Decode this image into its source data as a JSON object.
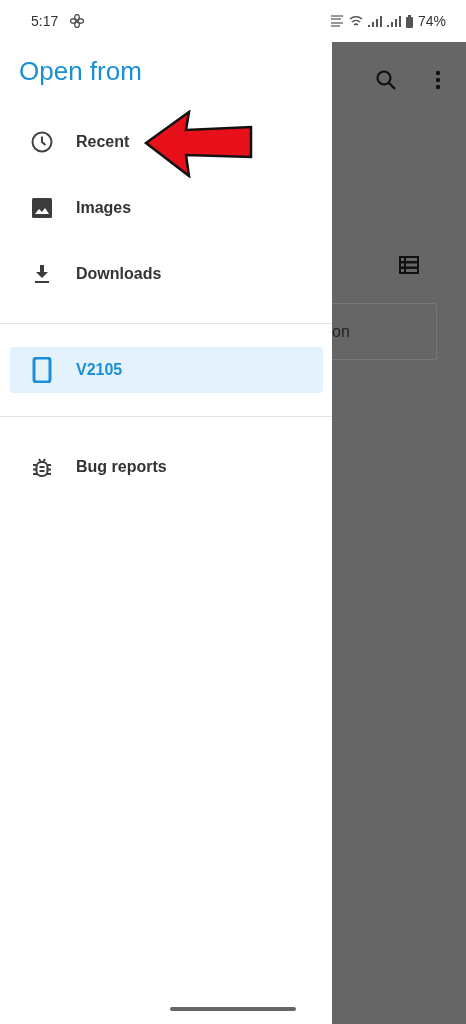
{
  "status_bar": {
    "time": "5:17",
    "battery": "74%"
  },
  "drawer": {
    "title": "Open from",
    "sections": [
      {
        "items": [
          {
            "label": "Recent",
            "selected": false
          },
          {
            "label": "Images",
            "selected": false
          },
          {
            "label": "Downloads",
            "selected": false
          }
        ]
      },
      {
        "items": [
          {
            "label": "V2105",
            "selected": true
          }
        ]
      },
      {
        "items": [
          {
            "label": "Bug reports",
            "selected": false
          }
        ]
      }
    ]
  },
  "background_app": {
    "card_text": "on"
  }
}
